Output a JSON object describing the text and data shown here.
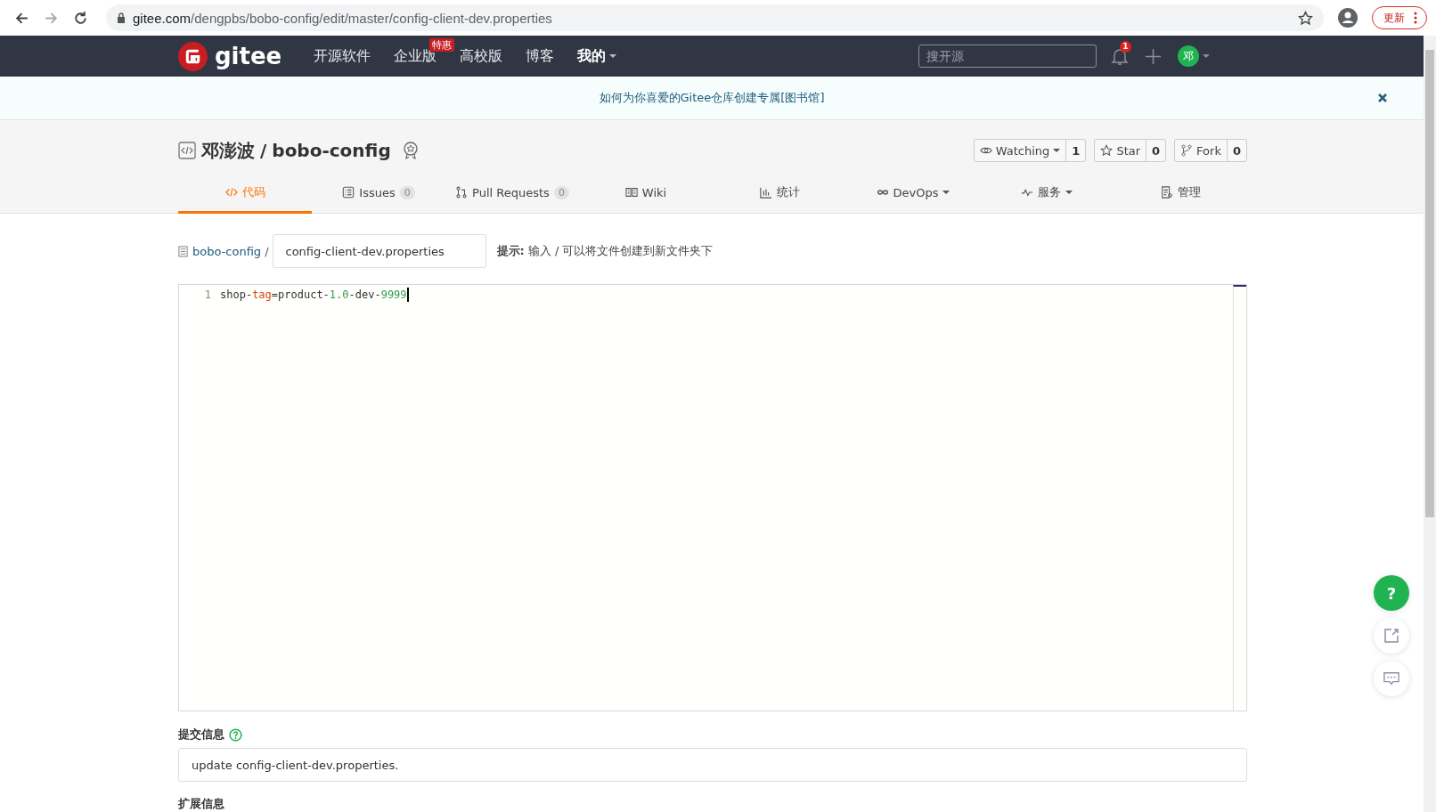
{
  "browser": {
    "url_host": "gitee.com",
    "url_path": "/dengpbs/bobo-config/edit/master/config-client-dev.properties",
    "update_button": "更新"
  },
  "navbar": {
    "logo_text": "gitee",
    "links": [
      {
        "label": "开源软件"
      },
      {
        "label": "企业版",
        "badge": "特惠"
      },
      {
        "label": "高校版"
      },
      {
        "label": "博客"
      }
    ],
    "my_menu": "我的",
    "search": {
      "placeholder": "搜开源"
    },
    "notification_count": "1",
    "avatar_letter": "邓"
  },
  "banner": {
    "text": "如何为你喜爱的Gitee仓库创建专属[图书馆]"
  },
  "repo": {
    "owner": "邓澎波",
    "separator": "/",
    "name": "bobo-config",
    "actions": [
      {
        "kind": "watch",
        "label": "Watching",
        "count": "1"
      },
      {
        "kind": "star",
        "label": "Star",
        "count": "0"
      },
      {
        "kind": "fork",
        "label": "Fork",
        "count": "0"
      }
    ],
    "tabs": [
      {
        "kind": "code",
        "label": "代码",
        "dropdown": false,
        "selected": true
      },
      {
        "kind": "issues",
        "label": "Issues",
        "count": "0",
        "dropdown": false,
        "selected": false
      },
      {
        "kind": "pr",
        "label": "Pull Requests",
        "count": "0",
        "dropdown": false,
        "selected": false
      },
      {
        "kind": "wiki",
        "label": "Wiki",
        "dropdown": false,
        "selected": false
      },
      {
        "kind": "stats",
        "label": "统计",
        "dropdown": false,
        "selected": false
      },
      {
        "kind": "devops",
        "label": "DevOps",
        "dropdown": true,
        "selected": false
      },
      {
        "kind": "service",
        "label": "服务",
        "dropdown": true,
        "selected": false
      },
      {
        "kind": "manage",
        "label": "管理",
        "dropdown": false,
        "selected": false
      }
    ]
  },
  "editor": {
    "breadcrumb": "bobo-config",
    "breadcrumb_sep": "/",
    "filename": "config-client-dev.properties",
    "hint_label": "提示:",
    "hint_text": "输入 / 可以将文件创建到新文件夹下",
    "lines": [
      {
        "number": "1",
        "tokens": [
          {
            "kind": "plain",
            "text": "shop-"
          },
          {
            "kind": "key",
            "text": "tag"
          },
          {
            "kind": "plain",
            "text": "=product-"
          },
          {
            "kind": "number",
            "text": "1.0"
          },
          {
            "kind": "plain",
            "text": "-dev-"
          },
          {
            "kind": "number",
            "text": "9999"
          }
        ]
      }
    ]
  },
  "commit": {
    "label": "提交信息",
    "value": "update config-client-dev.properties."
  },
  "extension_label": "扩展信息",
  "float_help": "?"
}
